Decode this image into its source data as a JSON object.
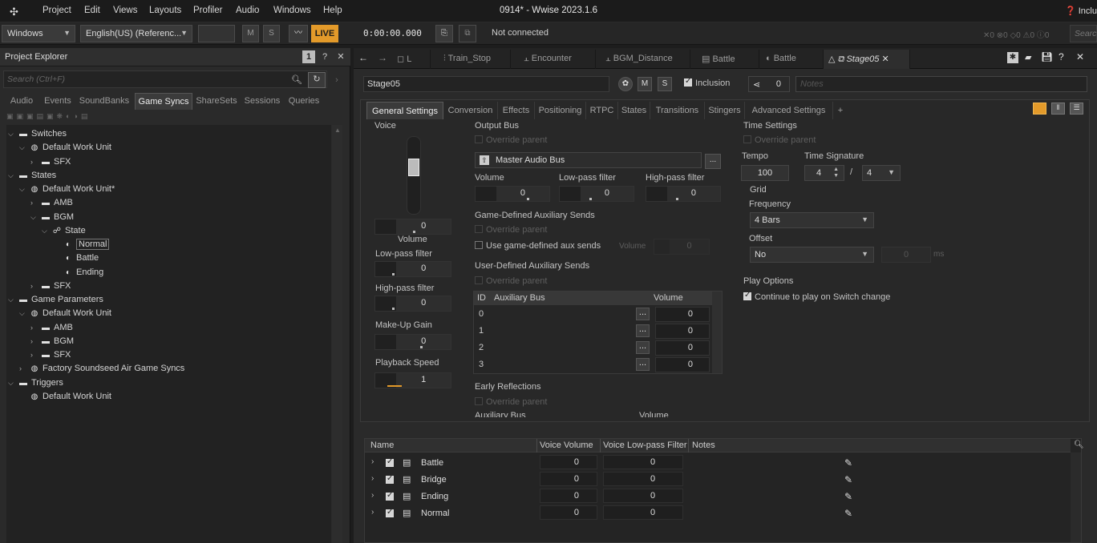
{
  "app": {
    "title": "0914* - Wwise 2023.1.6",
    "menu": [
      "Project",
      "Edit",
      "Views",
      "Layouts",
      "Profiler",
      "Audio",
      "Windows",
      "Help"
    ],
    "right_cut": "Inclu"
  },
  "toolbar": {
    "layout_combo": "Windows",
    "language_combo": "English(US) (Referenc...",
    "mute_label": "M",
    "solo_label": "S",
    "live_label": "LIVE",
    "timecode": "0:00:00.000",
    "connection_status": "Not connected",
    "counters": [
      "0",
      "0",
      "0",
      "0",
      "0"
    ],
    "search_placeholder": "Searc"
  },
  "project_explorer": {
    "title": "Project Explorer",
    "search_placeholder": "Search (Ctrl+F)",
    "tabs": [
      "Audio",
      "Events",
      "SoundBanks",
      "Game Syncs",
      "ShareSets",
      "Sessions",
      "Queries"
    ],
    "active_tab": "Game Syncs",
    "tree": [
      {
        "label": "Switches",
        "indent": 0,
        "chev": "v",
        "icon": "folder"
      },
      {
        "label": "Default Work Unit",
        "indent": 1,
        "chev": "v",
        "icon": "workunit"
      },
      {
        "label": "SFX",
        "indent": 2,
        "chev": ">",
        "icon": "folder"
      },
      {
        "label": "States",
        "indent": 0,
        "chev": "v",
        "icon": "folder"
      },
      {
        "label": "Default Work Unit*",
        "indent": 1,
        "chev": "v",
        "icon": "workunit"
      },
      {
        "label": "AMB",
        "indent": 2,
        "chev": ">",
        "icon": "folder"
      },
      {
        "label": "BGM",
        "indent": 2,
        "chev": "v",
        "icon": "folder"
      },
      {
        "label": "State",
        "indent": 3,
        "chev": "v",
        "icon": "stategroup"
      },
      {
        "label": "Normal",
        "indent": 4,
        "chev": "",
        "icon": "state",
        "selected": true
      },
      {
        "label": "Battle",
        "indent": 4,
        "chev": "",
        "icon": "state"
      },
      {
        "label": "Ending",
        "indent": 4,
        "chev": "",
        "icon": "state"
      },
      {
        "label": "SFX",
        "indent": 2,
        "chev": ">",
        "icon": "folder"
      },
      {
        "label": "Game Parameters",
        "indent": 0,
        "chev": "v",
        "icon": "folder"
      },
      {
        "label": "Default Work Unit",
        "indent": 1,
        "chev": "v",
        "icon": "workunit"
      },
      {
        "label": "AMB",
        "indent": 2,
        "chev": ">",
        "icon": "folder"
      },
      {
        "label": "BGM",
        "indent": 2,
        "chev": ">",
        "icon": "folder"
      },
      {
        "label": "SFX",
        "indent": 2,
        "chev": ">",
        "icon": "folder"
      },
      {
        "label": "Factory Soundseed Air Game Syncs",
        "indent": 1,
        "chev": ">",
        "icon": "workunit"
      },
      {
        "label": "Triggers",
        "indent": 0,
        "chev": "v",
        "icon": "folder"
      },
      {
        "label": "Default Work Unit",
        "indent": 1,
        "chev": "",
        "icon": "workunit"
      }
    ]
  },
  "doc_tabs": [
    "L",
    "Train_Stop",
    "Encounter",
    "BGM_Distance",
    "Battle",
    "Battle",
    "Stage05"
  ],
  "object": {
    "name": "Stage05",
    "mute": "M",
    "solo": "S",
    "inclusion_label": "Inclusion",
    "share_count": "0",
    "notes_placeholder": "Notes"
  },
  "settings_tabs": [
    "General Settings",
    "Conversion",
    "Effects",
    "Positioning",
    "RTPC",
    "States",
    "Transitions",
    "Stingers",
    "Advanced Settings",
    "+"
  ],
  "voice": {
    "title": "Voice",
    "volume_value": "0",
    "volume_label": "Volume",
    "lowpass_label": "Low-pass filter",
    "lowpass_value": "0",
    "highpass_label": "High-pass filter",
    "highpass_value": "0",
    "makeup_label": "Make-Up Gain",
    "makeup_value": "0",
    "speed_label": "Playback Speed",
    "speed_value": "1"
  },
  "output_bus": {
    "title": "Output Bus",
    "override": "Override parent",
    "bus_name": "Master Audio Bus",
    "browse": "...",
    "volume_label": "Volume",
    "volume_value": "0",
    "lowpass_label": "Low-pass filter",
    "lowpass_value": "0",
    "highpass_label": "High-pass filter",
    "highpass_value": "0"
  },
  "game_aux": {
    "title": "Game-Defined Auxiliary Sends",
    "override": "Override parent",
    "use_label": "Use game-defined aux sends",
    "volume_label": "Volume",
    "volume_value": "0"
  },
  "user_aux": {
    "title": "User-Defined Auxiliary Sends",
    "override": "Override parent",
    "headers": [
      "ID",
      "Auxiliary Bus",
      "Volume"
    ],
    "rows": [
      {
        "id": "0",
        "volume": "0"
      },
      {
        "id": "1",
        "volume": "0"
      },
      {
        "id": "2",
        "volume": "0"
      },
      {
        "id": "3",
        "volume": "0"
      }
    ],
    "browse": "..."
  },
  "early_reflections": {
    "title": "Early Reflections",
    "override": "Override parent",
    "aux_label": "Auxiliary Bus",
    "volume_label": "Volume"
  },
  "time_settings": {
    "title": "Time Settings",
    "override": "Override parent",
    "tempo_label": "Tempo",
    "tempo_value": "100",
    "signature_label": "Time Signature",
    "sig_num": "4",
    "sig_sep": "/",
    "sig_den": "4",
    "grid_label": "Grid",
    "frequency_label": "Frequency",
    "frequency_value": "4 Bars",
    "offset_label": "Offset",
    "offset_value": "No",
    "offset_num": "0",
    "offset_unit": "ms"
  },
  "play_options": {
    "title": "Play Options",
    "continue_label": "Continue to play on Switch change"
  },
  "state_list": {
    "headers": [
      "Name",
      "Voice Volume",
      "Voice Low-pass Filter",
      "Notes"
    ],
    "rows": [
      {
        "name": "Battle",
        "volume": "0",
        "lowpass": "0"
      },
      {
        "name": "Bridge",
        "volume": "0",
        "lowpass": "0"
      },
      {
        "name": "Ending",
        "volume": "0",
        "lowpass": "0"
      },
      {
        "name": "Normal",
        "volume": "0",
        "lowpass": "0"
      }
    ]
  }
}
